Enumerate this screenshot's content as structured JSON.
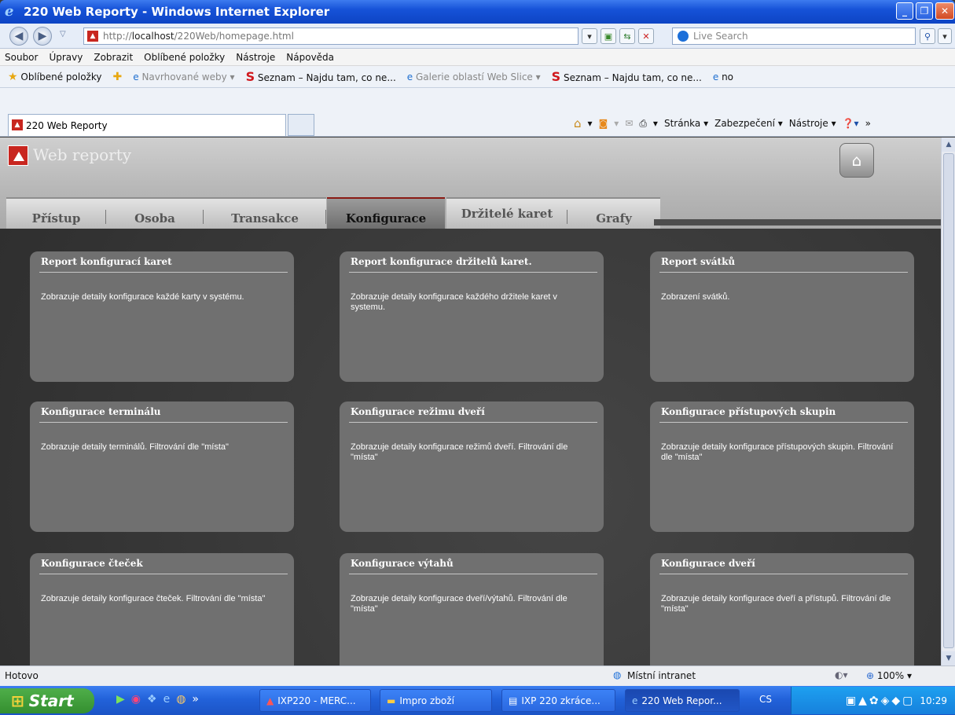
{
  "window": {
    "title": "220 Web Reporty - Windows Internet Explorer"
  },
  "address": {
    "url_prefix": "http://",
    "url_host": "localhost",
    "url_path": "/220Web/homepage.html",
    "search_placeholder": "Live Search"
  },
  "menu": [
    "Soubor",
    "Úpravy",
    "Zobrazit",
    "Oblíbené položky",
    "Nástroje",
    "Nápověda"
  ],
  "favorites": {
    "label": "Oblíbené položky",
    "items": [
      "Navrhované weby ▾",
      "Seznam – Najdu tam, co ne...",
      "Galerie oblastí Web Slice ▾",
      "Seznam – Najdu tam, co ne...",
      "no"
    ]
  },
  "tab": {
    "title": "220 Web Reporty"
  },
  "commands": [
    "Stránka ▾",
    "Zabezpečení ▾",
    "Nástroje ▾"
  ],
  "app": {
    "title": "Web reporty"
  },
  "nav": [
    {
      "label": "Přístup"
    },
    {
      "label": "Osoba"
    },
    {
      "label": "Transakce"
    },
    {
      "label": "Konfigurace"
    },
    {
      "label": "Držitelé karet"
    },
    {
      "label": "Grafy"
    }
  ],
  "cards": [
    {
      "title": "Report konfigurací karet",
      "desc": "Zobrazuje detaily konfigurace každé karty v systému."
    },
    {
      "title": "Report konfigurace držitelů karet.",
      "desc": "Zobrazuje detaily konfigurace každého držitele karet v systemu."
    },
    {
      "title": "Report svátků",
      "desc": "Zobrazení svátků."
    },
    {
      "title": "Konfigurace terminálu",
      "desc": "Zobrazuje detaily terminálů. Filtrování dle \"místa\""
    },
    {
      "title": "Konfigurace režimu dveří",
      "desc": "Zobrazuje detaily konfigurace režimů dveří. Filtrování dle \"místa\""
    },
    {
      "title": "Konfigurace přístupových skupin",
      "desc": "Zobrazuje detaily konfigurace přístupových skupin. Filtrování dle \"místa\""
    },
    {
      "title": "Konfigurace čteček",
      "desc": "Zobrazuje detaily konfigurace čteček. Filtrování dle \"místa\""
    },
    {
      "title": "Konfigurace výtahů",
      "desc": "Zobrazuje detaily konfigurace dveří/výtahů. Filtrování dle \"místa\""
    },
    {
      "title": "Konfigurace dveří",
      "desc": "Zobrazuje detaily konfigurace dveří a přístupů. Filtrování dle \"místa\""
    }
  ],
  "status": {
    "text": "Hotovo",
    "zone": "Místní intranet",
    "zoom": "100%"
  },
  "taskbar": {
    "start": "Start",
    "items": [
      "IXP220 - MERC...",
      "Impro zboží",
      "IXP 220 zkráce...",
      "220 Web Repor..."
    ],
    "lang": "CS",
    "clock": "10:29"
  },
  "colors": {
    "accent": "#8a1a14",
    "brand": "#c8261f",
    "card": "#707070"
  }
}
